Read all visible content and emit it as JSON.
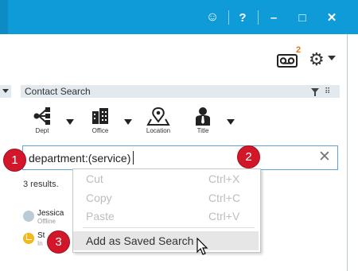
{
  "titlebar": {
    "buttons": [
      {
        "name": "smiley-icon",
        "glyph": "☺"
      },
      {
        "name": "help-icon",
        "glyph": "?"
      },
      {
        "name": "minimize-icon",
        "glyph": "–"
      },
      {
        "name": "maximize-icon",
        "glyph": "□"
      },
      {
        "name": "close-icon",
        "glyph": "✕"
      }
    ],
    "color": "#0f9bd7"
  },
  "voicemail": {
    "badge": "2",
    "badge_color": "#e0751d"
  },
  "contact_search": {
    "header": "Contact Search",
    "filters": [
      {
        "label": "Dept",
        "icon": "dept-icon"
      },
      {
        "label": "Office",
        "icon": "office-icon"
      },
      {
        "label": "Location",
        "icon": "location-icon"
      },
      {
        "label": "Title",
        "icon": "title-icon"
      }
    ],
    "query": "department:(service)",
    "results": "3 results."
  },
  "contacts": [
    {
      "name": "Jessica",
      "status": "Offline"
    },
    {
      "name": "St",
      "status": "In"
    }
  ],
  "context_menu": {
    "items": [
      {
        "label": "Cut",
        "shortcut": "Ctrl+X",
        "enabled": false
      },
      {
        "label": "Copy",
        "shortcut": "Ctrl+C",
        "enabled": false
      },
      {
        "label": "Paste",
        "shortcut": "Ctrl+V",
        "enabled": false
      },
      {
        "label": "Add as Saved Search",
        "shortcut": "",
        "enabled": true
      }
    ]
  },
  "markers": [
    "1",
    "2",
    "3"
  ]
}
